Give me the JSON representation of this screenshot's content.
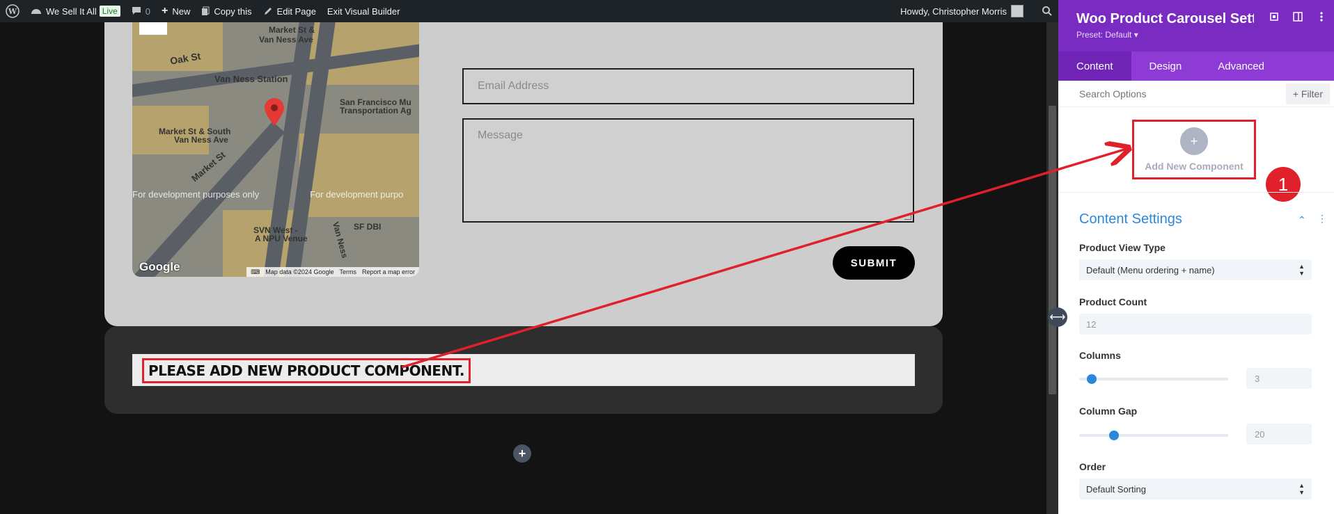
{
  "admin_bar": {
    "site_name": "We Sell It All",
    "live_badge": "Live",
    "comments_count": "0",
    "new_label": "New",
    "copy_label": "Copy this",
    "edit_label": "Edit Page",
    "exit_label": "Exit Visual Builder",
    "greeting": "Howdy, Christopher Morris"
  },
  "map": {
    "labels": [
      "Market St &",
      "Van Ness Ave",
      "Oak St",
      "Van Ness Station",
      "San Francisco Mu",
      "Transportation Ag",
      "Market St & South",
      "Van Ness Ave",
      "Market St",
      "SVN West -",
      "A NPU Venue",
      "SF DBI",
      "Van Ness"
    ],
    "dev_text": "For development purposes only",
    "dev_text_2": "For development purpo",
    "google": "Google",
    "footer": [
      "Map data ©2024 Google",
      "Terms",
      "Report a map error"
    ]
  },
  "form": {
    "email_placeholder": "Email Address",
    "message_placeholder": "Message",
    "submit_label": "SUBMIT"
  },
  "products": {
    "message": "PLEASE ADD NEW PRODUCT COMPONENT."
  },
  "panel": {
    "title": "Woo Product Carousel Setti...",
    "preset": "Preset: Default ▾",
    "tabs": [
      "Content",
      "Design",
      "Advanced"
    ],
    "search_placeholder": "Search Options",
    "filter_label": "+ Filter",
    "add_component_label": "Add New Component",
    "step_number": "1",
    "content_settings_title": "Content Settings",
    "product_view_type": {
      "label": "Product View Type",
      "value": "Default (Menu ordering + name)"
    },
    "product_count": {
      "label": "Product Count",
      "value": "12"
    },
    "columns": {
      "label": "Columns",
      "value": "3",
      "level": 0.05
    },
    "column_gap": {
      "label": "Column Gap",
      "value": "20",
      "level": 0.2
    },
    "order": {
      "label": "Order",
      "value": "Default Sorting"
    }
  },
  "colors": {
    "accent_purple": "#7a2bc1",
    "annotation_red": "#e0202a",
    "link_blue": "#2b87da"
  }
}
